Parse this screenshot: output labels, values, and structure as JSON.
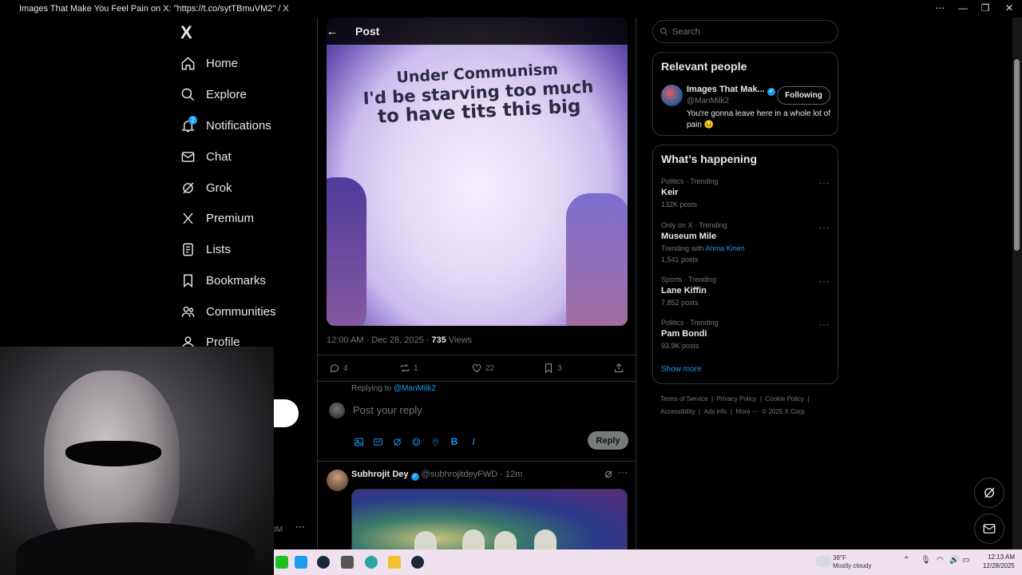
{
  "window": {
    "title": "Images That Make You Feel Pain on X: \"https://t.co/sytTBmuVM2\" / X",
    "controls": [
      "⋯",
      "—",
      "❐",
      "✕"
    ]
  },
  "nav": {
    "logo": "X",
    "items": [
      {
        "label": "Home",
        "icon": "home-icon"
      },
      {
        "label": "Explore",
        "icon": "search-icon"
      },
      {
        "label": "Notifications",
        "icon": "bell-icon",
        "badge": "2"
      },
      {
        "label": "Chat",
        "icon": "mail-icon"
      },
      {
        "label": "Grok",
        "icon": "grok-icon"
      },
      {
        "label": "Premium",
        "icon": "x-icon"
      },
      {
        "label": "Lists",
        "icon": "list-icon"
      },
      {
        "label": "Bookmarks",
        "icon": "bookmark-icon"
      },
      {
        "label": "Communities",
        "icon": "people-icon"
      },
      {
        "label": "Profile",
        "icon": "person-icon"
      }
    ],
    "more_dots": "···",
    "partial_text": "IM"
  },
  "post": {
    "header_title": "Post",
    "image_text": [
      "Under Communism",
      "I'd be starving too much",
      "to have tits this big"
    ],
    "time": "12:00 AM · Dec 28, 2025 · ",
    "views_count": "735",
    "views_label": " Views",
    "replies": "4",
    "reposts": "1",
    "likes": "22",
    "bookmarks": "3"
  },
  "reply_box": {
    "replying_to_label": "Replying to ",
    "replying_to_handle": "@ManMilk2",
    "placeholder": "Post your reply",
    "reply_button": "Reply",
    "format_bold": "B",
    "format_italic": "I"
  },
  "reply_post": {
    "name": "Subhrojit Dey",
    "handle": "@subhrojitdeyFWD",
    "time": "· 12m"
  },
  "search": {
    "placeholder": "Search"
  },
  "relevant": {
    "title": "Relevant people",
    "name": "Images That Mak...",
    "handle": "@ManMilk2",
    "bio": "You're gonna leave here in a whole lot of pain 😣",
    "follow_button": "Following"
  },
  "happening": {
    "title": "What’s happening",
    "trends": [
      {
        "category": "Politics · Trending",
        "name": "Keir",
        "count": "132K posts"
      },
      {
        "category": "Only on X · Trending",
        "name": "Museum Mile",
        "with_label": "Trending with ",
        "with_link": "Arima Kinen",
        "count": "1,541 posts"
      },
      {
        "category": "Sports · Trending",
        "name": "Lane Kiffin",
        "count": "7,852 posts"
      },
      {
        "category": "Politics · Trending",
        "name": "Pam Bondi",
        "count": "93.9K posts"
      }
    ],
    "show_more": "Show more"
  },
  "footer": {
    "links": [
      "Terms of Service",
      "Privacy Policy",
      "Cookie Policy",
      "Accessibility",
      "Ads info",
      "More ···"
    ],
    "copyright": "© 2025 X Corp.",
    "sep": "|"
  },
  "taskbar": {
    "weather_temp": "38°F",
    "weather_desc": "Mostly cloudy",
    "time": "12:13 AM",
    "date": "12/28/2025"
  },
  "colors": {
    "accent": "#1d9bf0",
    "border": "#2f3336",
    "muted": "#71767b"
  }
}
